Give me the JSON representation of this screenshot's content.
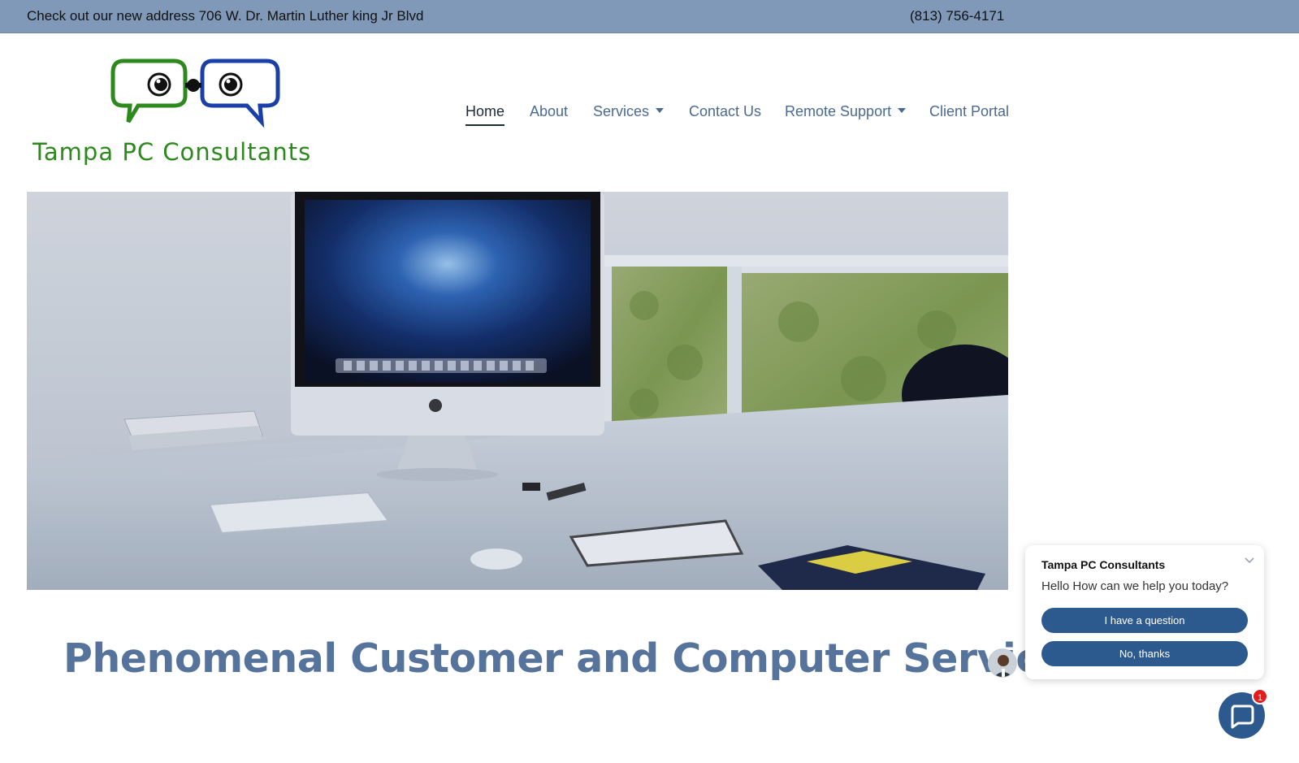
{
  "topbar": {
    "announcement": "Check out our new address 706 W. Dr. Martin Luther king Jr Blvd",
    "phone": "(813) 756-4171"
  },
  "logo": {
    "text": "Tampa PC Consultants",
    "colors": {
      "green": "#2c8a1d",
      "blue": "#1a3fa8"
    }
  },
  "nav": {
    "items": [
      {
        "label": "Home",
        "active": true,
        "dropdown": false
      },
      {
        "label": "About",
        "active": false,
        "dropdown": false
      },
      {
        "label": "Services",
        "active": false,
        "dropdown": true
      },
      {
        "label": "Contact Us",
        "active": false,
        "dropdown": false
      },
      {
        "label": "Remote Support",
        "active": false,
        "dropdown": true
      },
      {
        "label": "Client Portal",
        "active": false,
        "dropdown": false
      }
    ]
  },
  "hero": {
    "icon": "desk-workspace-photo"
  },
  "main": {
    "headline": "Phenomenal Customer and Computer Service"
  },
  "chat": {
    "company": "Tampa PC Consultants",
    "greeting": "Hello How can we help you today?",
    "buttons": {
      "question": "I have a question",
      "decline": "No, thanks"
    },
    "badge_count": "1",
    "accent": "#2d5a8e"
  },
  "colors": {
    "topbar": "#8099b9",
    "nav_text": "#4a6a93",
    "headline": "#56739b"
  }
}
